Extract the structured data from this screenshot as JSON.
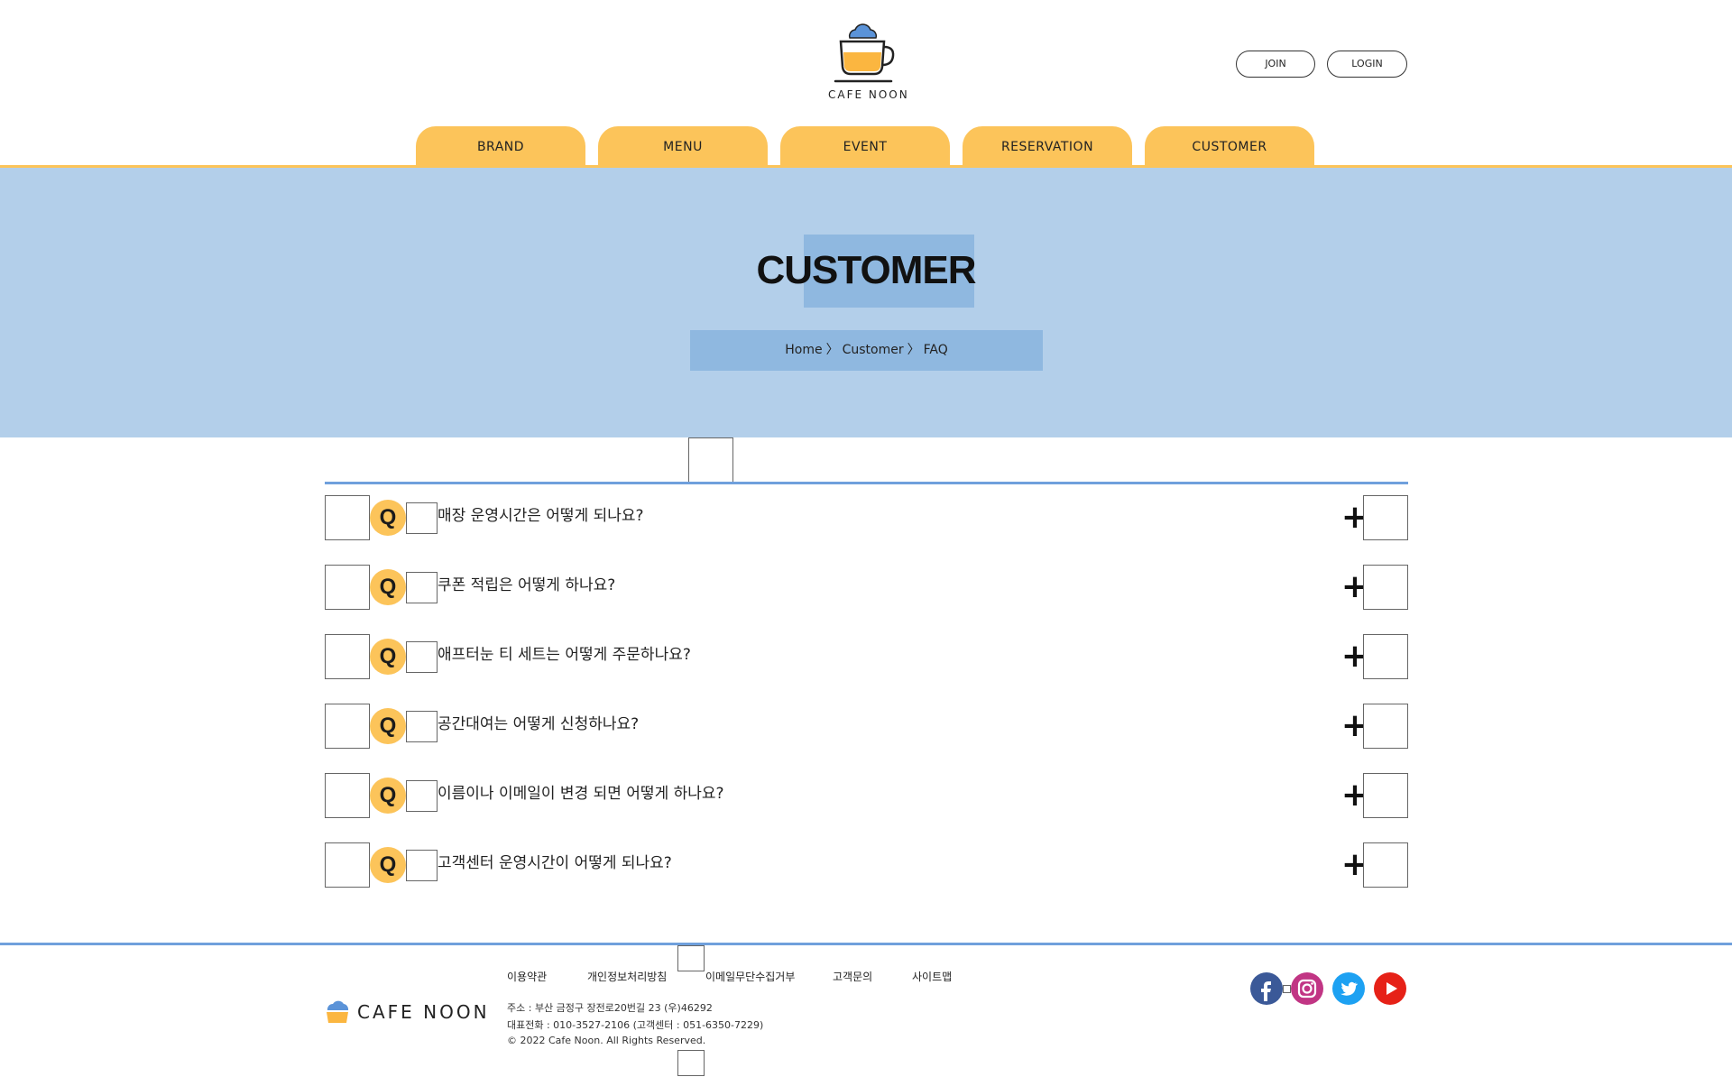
{
  "header": {
    "brand": "CAFE NOON",
    "join_label": "JOIN",
    "login_label": "LOGIN"
  },
  "nav": {
    "items": [
      {
        "label": "BRAND"
      },
      {
        "label": "MENU"
      },
      {
        "label": "EVENT"
      },
      {
        "label": "RESERVATION"
      },
      {
        "label": "CUSTOMER"
      }
    ]
  },
  "hero": {
    "title": "CUSTOMER",
    "breadcrumb": [
      "Home",
      "Customer",
      "FAQ"
    ],
    "separator": "〉"
  },
  "faq": {
    "badge": "Q",
    "expand_symbol": "+",
    "items": [
      {
        "question": "매장 운영시간은 어떻게 되나요?"
      },
      {
        "question": "쿠폰 적립은 어떻게 하나요?"
      },
      {
        "question": "애프터눈 티 세트는 어떻게 주문하나요?"
      },
      {
        "question": "공간대여는 어떻게 신청하나요?"
      },
      {
        "question": "이름이나 이메일이 변경 되면 어떻게 하나요?"
      },
      {
        "question": "고객센터 운영시간이 어떻게 되나요?"
      }
    ]
  },
  "footer": {
    "brand": "CAFE NOON",
    "links": [
      "이용약관",
      "개인정보처리방침",
      "이메일무단수집거부",
      "고객문의",
      "사이트맵"
    ],
    "address": "주소 : 부산 금정구 장전로20번길 23 (우)46292",
    "phone": "대표전화 : 010-3527-2106 (고객센터 : 051-6350-7229)",
    "copyright": "© 2022 Cafe Noon. All Rights Reserved.",
    "social": [
      "facebook-icon",
      "instagram-icon",
      "twitter-icon",
      "youtube-icon"
    ],
    "colors": {
      "facebook": "#3b5998",
      "instagram": "#c13584",
      "twitter": "#1da1f2",
      "youtube": "#e62117"
    }
  },
  "colors": {
    "accent_yellow": "#fcc45a",
    "hero_blue": "#b3cfea",
    "title_blue": "#8fb8e0",
    "line_blue": "#6fa0dc"
  }
}
